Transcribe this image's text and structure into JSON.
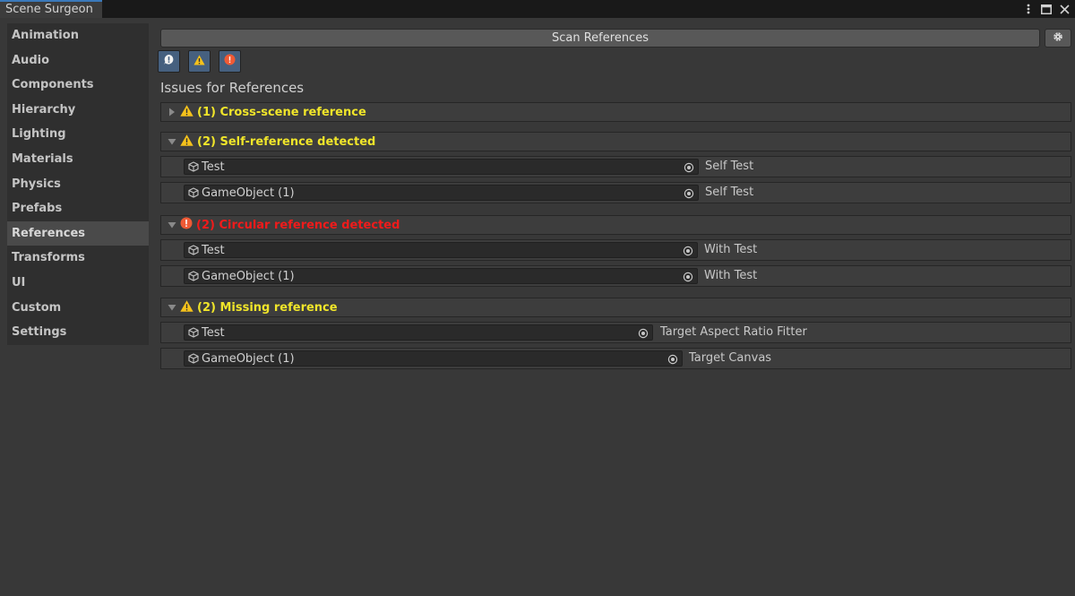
{
  "window": {
    "tab_title": "Scene Surgeon"
  },
  "sidebar": {
    "items": [
      {
        "label": "Animation"
      },
      {
        "label": "Audio"
      },
      {
        "label": "Components"
      },
      {
        "label": "Hierarchy"
      },
      {
        "label": "Lighting"
      },
      {
        "label": "Materials"
      },
      {
        "label": "Physics"
      },
      {
        "label": "Prefabs"
      },
      {
        "label": "References",
        "active": true
      },
      {
        "label": "Transforms"
      },
      {
        "label": "UI"
      },
      {
        "label": "Custom"
      },
      {
        "label": "Settings"
      }
    ]
  },
  "toolbar": {
    "scan_label": "Scan References",
    "settings_icon": "gear-icon",
    "filters": [
      {
        "icon": "info-icon",
        "active": true
      },
      {
        "icon": "warning-icon",
        "active": true
      },
      {
        "icon": "error-icon",
        "active": true
      }
    ]
  },
  "main": {
    "title": "Issues for References",
    "groups": [
      {
        "title": "(1) Cross-scene reference",
        "severity": "warning",
        "expanded": false,
        "rows": []
      },
      {
        "title": "(2) Self-reference detected",
        "severity": "warning",
        "expanded": true,
        "rows": [
          {
            "object": "Test",
            "label": "Self Test"
          },
          {
            "object": "GameObject (1)",
            "label": "Self Test"
          }
        ]
      },
      {
        "title": "(2) Circular reference detected",
        "severity": "error",
        "expanded": true,
        "rows": [
          {
            "object": "Test",
            "label": "With Test"
          },
          {
            "object": "GameObject (1)",
            "label": "With Test"
          }
        ]
      },
      {
        "title": "(2) Missing reference",
        "severity": "warning",
        "expanded": true,
        "rows": [
          {
            "object": "Test",
            "label": "Target Aspect Ratio Fitter"
          },
          {
            "object": "GameObject (1)",
            "label": "Target Canvas"
          }
        ]
      }
    ]
  },
  "colors": {
    "warning_text": "#f0e52a",
    "error_text": "#f01b1b",
    "active_tab_accent": "#3a79bb",
    "filter_button": "#46607f"
  }
}
